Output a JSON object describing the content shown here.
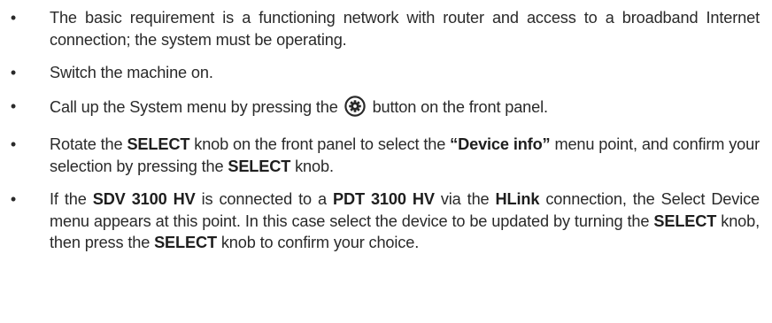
{
  "bullet_glyph": "•",
  "items": [
    {
      "text": "The basic requirement is a functioning network with router and access to a broadband Internet connection; the system must be operating."
    },
    {
      "text": "Switch the machine on."
    },
    {
      "before": "Call up the System menu by pressing the",
      "icon": "settings-gear-icon",
      "after": "button on the front panel."
    },
    {
      "p1": "Rotate the ",
      "b1": "SELECT",
      "p2": " knob on the front panel to select the ",
      "b2": "“Device info”",
      "p3": " menu point, and confirm your selection by pressing the ",
      "b3": "SELECT",
      "p4": " knob."
    },
    {
      "p1": "If the ",
      "b1": "SDV 3100 HV",
      "p2": " is connected to a ",
      "b2": "PDT 3100 HV",
      "p3": " via the ",
      "b3": "HLink",
      "p4": " connection, the Select Device menu appears at this point. In this case select the device to be updated by turning the ",
      "b4": "SELECT",
      "p5": " knob, then press the ",
      "b5": "SELECT",
      "p6": " knob to confirm your choice."
    }
  ]
}
